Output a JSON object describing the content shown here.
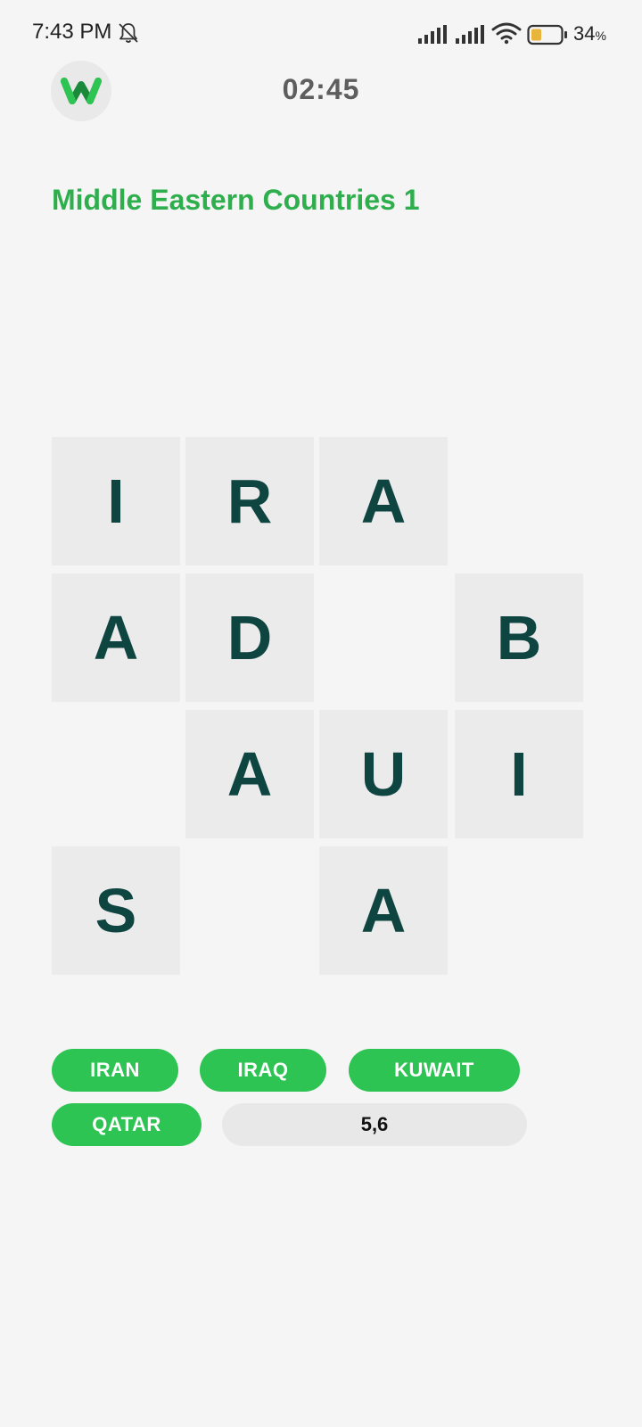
{
  "status_bar": {
    "time": "7:43 PM",
    "battery_percent": "34",
    "battery_unit": "%",
    "icons": [
      "bell-off-icon",
      "signal-icon",
      "signal-icon",
      "wifi-icon",
      "battery-icon"
    ],
    "battery_fill_color": "#e8b43a"
  },
  "header": {
    "logo_icon": "w-logo-icon",
    "timer": "02:45"
  },
  "puzzle": {
    "title": "Middle Eastern Countries 1"
  },
  "grid": {
    "rows": [
      [
        "I",
        "R",
        "A",
        ""
      ],
      [
        "A",
        "D",
        "",
        "B"
      ],
      [
        "",
        "A",
        "U",
        "I"
      ],
      [
        "S",
        "",
        "A",
        ""
      ]
    ]
  },
  "found_words": {
    "words": [
      "IRAN",
      "IRAQ",
      "KUWAIT",
      "QATAR"
    ],
    "hint": "5,6"
  },
  "colors": {
    "accent_green": "#2eae4d",
    "chip_green": "#2ec453",
    "tile_bg": "#ebebeb",
    "tile_text": "#0f4541",
    "timer": "#5e5e5e"
  }
}
